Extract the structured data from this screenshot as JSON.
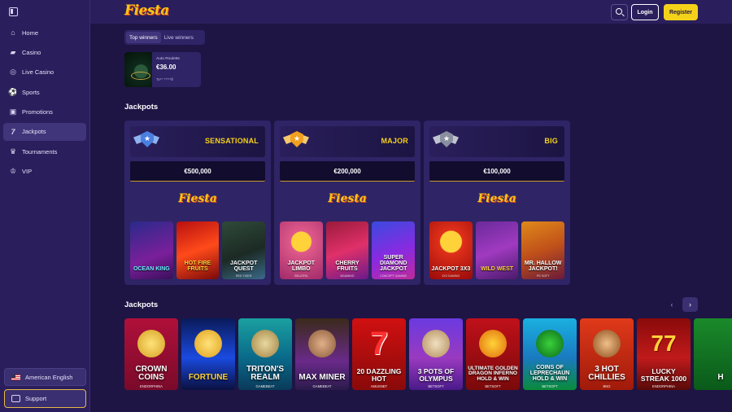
{
  "header": {
    "logo": "Fiesta",
    "login_label": "Login",
    "register_label": "Register"
  },
  "sidebar": {
    "items": [
      {
        "label": "Home",
        "icon": "home-icon"
      },
      {
        "label": "Casino",
        "icon": "cards-icon"
      },
      {
        "label": "Live Casino",
        "icon": "roulette-icon"
      },
      {
        "label": "Sports",
        "icon": "soccer-ball-icon"
      },
      {
        "label": "Promotions",
        "icon": "gift-icon"
      },
      {
        "label": "Jackpots",
        "icon": "seven-icon"
      },
      {
        "label": "Tournaments",
        "icon": "trophy-icon"
      },
      {
        "label": "VIP",
        "icon": "crown-icon"
      }
    ],
    "active_index": 5,
    "language": "American English",
    "support": "Support"
  },
  "winners": {
    "tabs": [
      "Top winners",
      "Live winners"
    ],
    "active_tab": 0,
    "card": {
      "game": "Auto Roulette",
      "amount": "€36.00",
      "user": "Ta** *****ill"
    }
  },
  "jackpots_section": {
    "title": "Jackpots",
    "logo": "Fiesta",
    "cards": [
      {
        "name": "SENSATIONAL",
        "amount": "€500,000",
        "badge_color": "#4a7fe0",
        "games": [
          {
            "title": "OCEAN KING",
            "provider": ""
          },
          {
            "title": "HOT FIRE FRUITS",
            "provider": ""
          },
          {
            "title": "JACKPOT QUEST",
            "provider": "RED TIGER"
          }
        ]
      },
      {
        "name": "MAJOR",
        "amount": "€200,000",
        "badge_color": "#f0a020",
        "games": [
          {
            "title": "JACKPOT LIMBO",
            "provider": "BELATRA"
          },
          {
            "title": "CHERRY FRUITS",
            "provider": "BGAMING"
          },
          {
            "title": "SUPER DIAMOND JACKPOT",
            "provider": "CONCEPT GAMING"
          }
        ]
      },
      {
        "name": "BIG",
        "amount": "€100,000",
        "badge_color": "#8a8fa0",
        "games": [
          {
            "title": "JACKPOT 3X3",
            "provider": "3X3 GAMING"
          },
          {
            "title": "WILD WEST",
            "provider": ""
          },
          {
            "title": "MR. HALLOW JACKPOT!",
            "provider": "PG SOFT"
          }
        ]
      }
    ]
  },
  "carousel": {
    "title": "Jackpots",
    "prev_icon": "chevron-left-icon",
    "next_icon": "chevron-right-icon",
    "games": [
      {
        "title": "CROWN COINS",
        "provider": "ENDORPHINA"
      },
      {
        "title": "FORTUNE",
        "provider": ""
      },
      {
        "title": "TRITON'S REALM",
        "provider": "GAMEBEAT"
      },
      {
        "title": "MAX MINER",
        "provider": "GAMEBEAT"
      },
      {
        "title": "20 DAZZLING HOT",
        "provider": "AMUSNET"
      },
      {
        "title": "3 POTS OF OLYMPUS",
        "provider": "BETSOFT"
      },
      {
        "title": "ULTIMATE GOLDEN DRAGON INFERNO HOLD & WIN",
        "provider": "BETSOFT"
      },
      {
        "title": "COINS OF LEPRECHAUN HOLD & WIN",
        "provider": "BETSOFT"
      },
      {
        "title": "3 HOT CHILLIES",
        "provider": "BNG"
      },
      {
        "title": "LUCKY STREAK 1000",
        "provider": "ENDORPHINA"
      },
      {
        "title": "H",
        "provider": ""
      }
    ]
  }
}
